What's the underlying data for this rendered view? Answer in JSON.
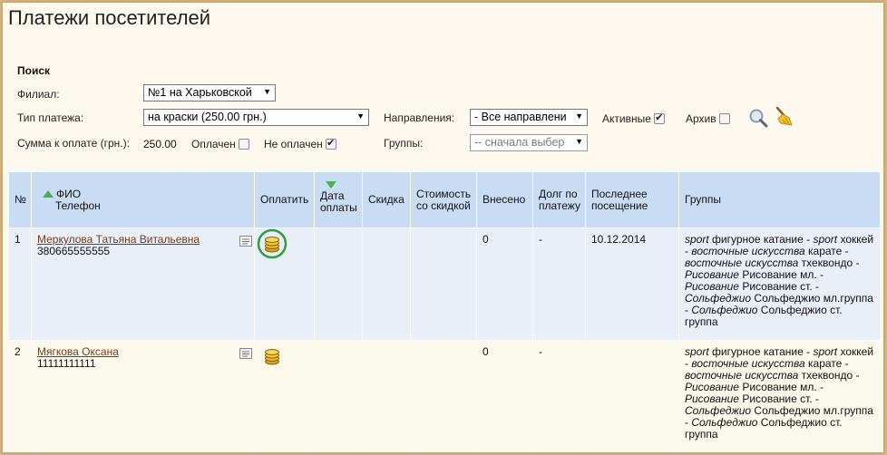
{
  "page": {
    "title": "Платежи посетителей"
  },
  "search": {
    "title": "Поиск",
    "branch_label": "Филиал:",
    "branch_value": "№1 на Харьковской",
    "payment_type_label": "Тип платежа:",
    "payment_type_value": "на краски (250.00 грн.)",
    "direction_label": "Направления:",
    "direction_value": "- Все направлени",
    "active_label": "Активные",
    "active_checked": true,
    "archive_label": "Архив",
    "archive_checked": false,
    "amount_label": "Сумма к оплате (грн.):",
    "amount_value": "250.00",
    "paid_label": "Оплачен",
    "paid_checked": false,
    "unpaid_label": "Не оплачен",
    "unpaid_checked": true,
    "groups_label": "Группы:",
    "groups_value": "-- сначала выбер"
  },
  "table": {
    "headers": {
      "num": "№",
      "fio": "ФИО",
      "phone": "Телефон",
      "pay": "Оплатить",
      "date": "Дата оплаты",
      "discount": "Скидка",
      "cost_discount": "Стоимость со скидкой",
      "paid_in": "Внесено",
      "debt": "Долг по платежу",
      "last_visit": "Последнее посещение",
      "groups": "Группы"
    },
    "rows": [
      {
        "num": "1",
        "name": "Меркулова Татьяна Витальевна",
        "phone": "380665555555",
        "paid_in": "0",
        "debt": "-",
        "last_visit": "10.12.2014",
        "highlighted": true
      },
      {
        "num": "2",
        "name": "Мягкова Оксана",
        "phone": "11111111111",
        "paid_in": "0",
        "debt": "-",
        "last_visit": "",
        "highlighted": false
      }
    ],
    "groups_text": [
      {
        "cat": "sport",
        "name": " фигурное катание - "
      },
      {
        "cat": "sport",
        "name": " хоккей - "
      },
      {
        "cat": "восточные искусства",
        "name": " карате - "
      },
      {
        "cat": "восточные искусства",
        "name": " тхеквондо - "
      },
      {
        "cat": "Рисование",
        "name": " Рисование мл. - "
      },
      {
        "cat": "Рисование",
        "name": " Рисование ст. - "
      },
      {
        "cat": "Сольфеджио",
        "name": " Сольфеджио мл.группа - "
      },
      {
        "cat": "Сольфеджио",
        "name": " Сольфеджио ст. группа"
      }
    ]
  },
  "colors": {
    "header_bg": "#c8dcf4",
    "row_highlight": "#e8eff9",
    "link": "#7a3b14",
    "sort_arrow": "#4caf50",
    "highlight_circle": "#2e9e3e"
  },
  "icons": {
    "search": "search-icon",
    "clear": "broom-icon",
    "pay": "coins-icon",
    "note": "note-icon"
  }
}
